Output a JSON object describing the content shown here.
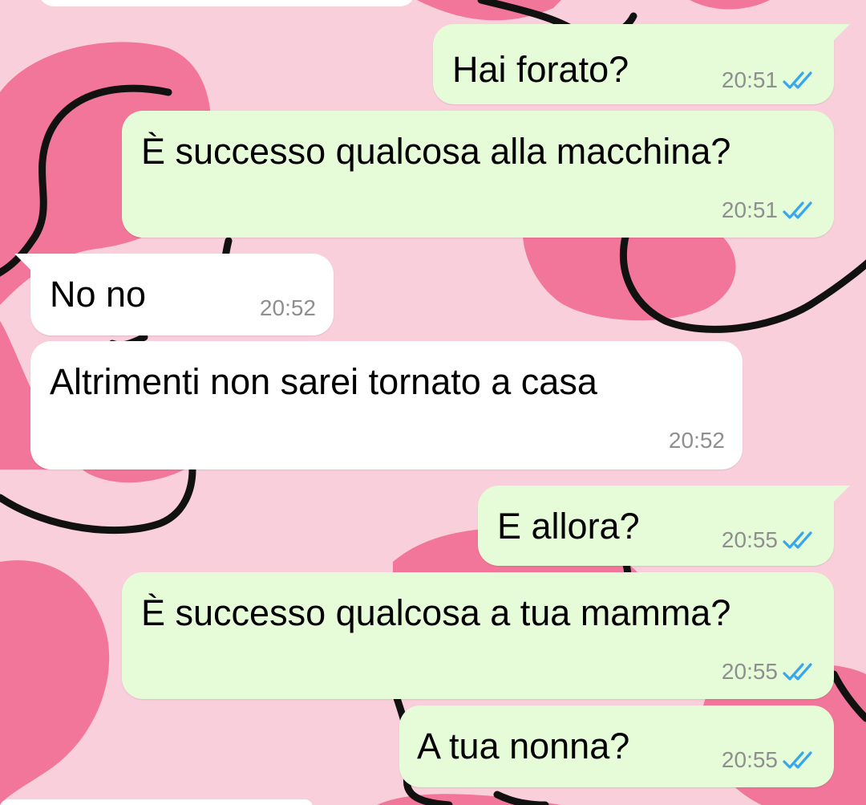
{
  "theme": {
    "wallpaper_bg": "#f9cfdc",
    "blob_color": "#f2759a",
    "line_color": "#111111",
    "outgoing_bubble": "#e6fbd8",
    "incoming_bubble": "#ffffff",
    "time_color": "#8f8f8f",
    "read_tick_color": "#35a6ef"
  },
  "messages": [
    {
      "direction": "outgoing",
      "text": "Hai forato?",
      "time": "20:51",
      "status": "read",
      "status_icon": "double-check-icon"
    },
    {
      "direction": "outgoing",
      "text": "È successo qualcosa alla macchina?",
      "time": "20:51",
      "status": "read",
      "status_icon": "double-check-icon"
    },
    {
      "direction": "incoming",
      "text": "No no",
      "time": "20:52"
    },
    {
      "direction": "incoming",
      "text": "Altrimenti non sarei tornato a casa",
      "time": "20:52"
    },
    {
      "direction": "outgoing",
      "text": "E allora?",
      "time": "20:55",
      "status": "read",
      "status_icon": "double-check-icon"
    },
    {
      "direction": "outgoing",
      "text": "È successo qualcosa a tua mamma?",
      "time": "20:55",
      "status": "read",
      "status_icon": "double-check-icon"
    },
    {
      "direction": "outgoing",
      "text": "A tua nonna?",
      "time": "20:55",
      "status": "read",
      "status_icon": "double-check-icon"
    }
  ]
}
